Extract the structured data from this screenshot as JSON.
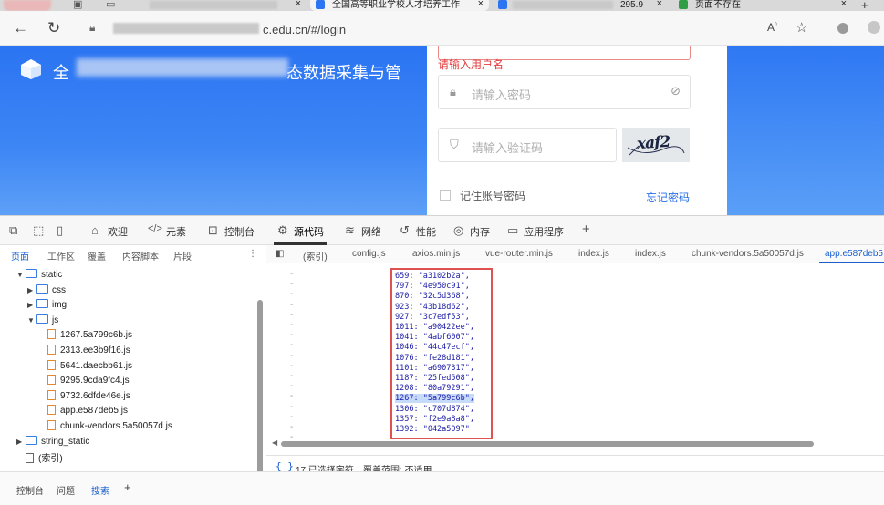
{
  "browser": {
    "tabs": [
      {
        "title": "全国高等职业学校人才培养工作",
        "close": "×"
      },
      {
        "title": "295.9",
        "close": "×"
      },
      {
        "title": "页面不存在",
        "close": "×"
      }
    ],
    "new_tab": "+",
    "url": "c.edu.cn/#/login"
  },
  "page": {
    "site_title_start": "全",
    "site_title_end": "态数据采集与管",
    "error_text": "请输入用户名",
    "password_placeholder": "请输入密码",
    "captcha_placeholder": "请输入验证码",
    "captcha_image_text": "xaf2",
    "remember_label": "记住账号密码",
    "forgot_link": "忘记密码",
    "brand_color": "#2b74f2",
    "error_color": "#e43c3c"
  },
  "devtools": {
    "tools": [
      {
        "label": "欢迎",
        "icon": "home-icon"
      },
      {
        "label": "元素",
        "icon": "code-tag-icon"
      },
      {
        "label": "控制台",
        "icon": "console-icon"
      },
      {
        "label": "源代码",
        "icon": "bug-icon"
      },
      {
        "label": "网络",
        "icon": "wifi-icon"
      },
      {
        "label": "性能",
        "icon": "performance-icon"
      },
      {
        "label": "内存",
        "icon": "memory-icon"
      },
      {
        "label": "应用程序",
        "icon": "application-icon"
      }
    ],
    "add_tool": "+",
    "nav_tabs": [
      "页面",
      "工作区",
      "覆盖",
      "内容脚本",
      "片段"
    ],
    "nav_more": "⋮",
    "tree": [
      {
        "label": "static",
        "type": "folder",
        "open": true,
        "indent": 1
      },
      {
        "label": "css",
        "type": "folder",
        "open": false,
        "indent": 2
      },
      {
        "label": "img",
        "type": "folder",
        "open": false,
        "indent": 2
      },
      {
        "label": "js",
        "type": "folder",
        "open": true,
        "indent": 2
      },
      {
        "label": "1267.5a799c6b.js",
        "type": "file",
        "indent": 3
      },
      {
        "label": "2313.ee3b9f16.js",
        "type": "file",
        "indent": 3
      },
      {
        "label": "5641.daecbb61.js",
        "type": "file",
        "indent": 3
      },
      {
        "label": "9295.9cda9fc4.js",
        "type": "file",
        "indent": 3
      },
      {
        "label": "9732.6dfde46e.js",
        "type": "file",
        "indent": 3
      },
      {
        "label": "app.e587deb5.js",
        "type": "file",
        "indent": 3
      },
      {
        "label": "chunk-vendors.5a50057d.js",
        "type": "file",
        "indent": 3
      },
      {
        "label": "string_static",
        "type": "folder",
        "open": false,
        "indent": 1
      },
      {
        "label": "(索引)",
        "type": "plainfile",
        "indent": 1
      }
    ],
    "file_tabs": [
      "(索引)",
      "config.js",
      "axios.min.js",
      "vue-router.min.js",
      "index.js",
      "index.js",
      "chunk-vendors.5a50057d.js",
      "app.e587deb5."
    ],
    "code_lines": [
      "659: \"a3102b2a\",",
      "797: \"4e950c91\",",
      "870: \"32c5d368\",",
      "923: \"43b18d62\",",
      "927: \"3c7edf53\",",
      "1011: \"a90422ee\",",
      "1041: \"4abf6007\",",
      "1046: \"44c47ecf\",",
      "1076: \"fe28d181\",",
      "1101: \"a6907317\",",
      "1187: \"25fed508\",",
      "1208: \"80a79291\",",
      "1267: \"5a799c6b\",",
      "1306: \"c707d874\",",
      "1357: \"f2e9a8a8\",",
      "1392: \"042a5097\""
    ],
    "highlighted_line": 12,
    "status": {
      "brace": "{ }",
      "selection": "17 已选择字符",
      "coverage": "覆盖范围: 不适用"
    },
    "drawer_tabs": [
      "控制台",
      "问题",
      "搜索"
    ],
    "drawer_add": "+"
  }
}
